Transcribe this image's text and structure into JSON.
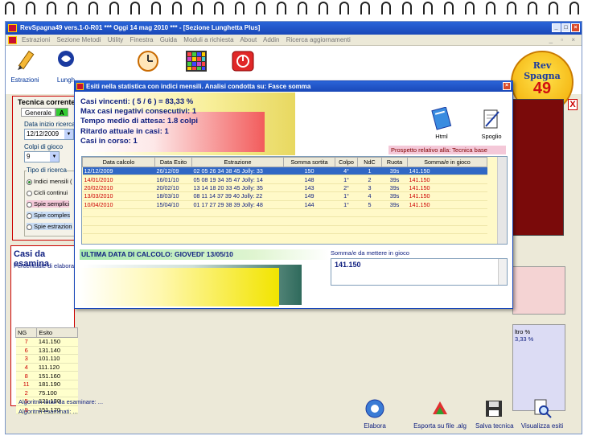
{
  "window": {
    "title": "RevSpagna49 vers.1-0-R01  ***  Oggi 14 mag 2010  ***  - [Sezione Lunghetta Plus]"
  },
  "menu": [
    "Estrazioni",
    "Sezione Metodi",
    "Utility",
    "Finestra",
    "Guida",
    "Moduli a richiesta",
    "About",
    "Addin",
    "Ricerca aggiornamenti"
  ],
  "toolbar": {
    "estrazioni": "Estrazioni",
    "lunghetta": "Lungh"
  },
  "logo": {
    "l1": "Rev",
    "l2": "Spagna",
    "l3": "49"
  },
  "left_panel": {
    "title": "Tecnica corrente:",
    "tab_general": "Generale",
    "tab_a": "A",
    "data_inizio_label": "Data inizio ricerca",
    "data_inizio_value": "12/12/2009",
    "colpi_label": "Colpi di gioco",
    "colpi_value": "9",
    "tipo_ricerca_label": "Tipo di ricerca",
    "options": [
      "Indici mensili (",
      "Cicli continui",
      "Spie semplici",
      "Spie comples",
      "Spie estrazion"
    ]
  },
  "cases_panel": {
    "title": "Casi da esamina",
    "subtitle": "Percentuale di elabora:"
  },
  "ng_table": {
    "headers": [
      "NG",
      "Esito"
    ],
    "rows": [
      [
        "7",
        "141.150"
      ],
      [
        "6",
        "131.140"
      ],
      [
        "3",
        "101.110"
      ],
      [
        "4",
        "111.120"
      ],
      [
        "8",
        "151.160"
      ],
      [
        "11",
        "181.190"
      ],
      [
        "2",
        "75.100"
      ],
      [
        "5",
        "121.130"
      ],
      [
        "9",
        "151.170"
      ]
    ]
  },
  "bottom_labels": {
    "totali": "Algoritmi totali da esaminare:  ...",
    "esaminati": "Algoritmi esaminati:  ..."
  },
  "right_panel": {
    "filtro": "ltro %",
    "pct": "3,33 %"
  },
  "bottom_buttons": [
    "Elabora",
    "Esporta su file .alg",
    "Salva tecnica",
    "Visualizza esiti"
  ],
  "dialog": {
    "title": "Esiti nella statistica con indici mensili. Analisi condotta su: Fasce somma",
    "summary": [
      "Casi vincenti: ( 5 / 6 ) = 83,33 %",
      "Max casi negativi consecutivi: 1",
      "Tempo medio di attesa: 1.8 colpi",
      "Ritardo attuale in casi: 1",
      "Casi in corso: 1"
    ],
    "html_label": "Html",
    "spoglio_label": "Spoglio",
    "prospetto": "Prospetto relativo alla: Tecnica base",
    "columns": [
      "Data calcolo",
      "Data Esito",
      "Estrazione",
      "Somma sortita",
      "Colpo",
      "NdC",
      "Ruota",
      "Somma/e in gioco"
    ],
    "rows": [
      [
        "12/12/2009",
        "26/12/09",
        "02 05 26 34 38 45 Jolly: 33",
        "150",
        "4°",
        "1",
        "39s",
        "141.150"
      ],
      [
        "14/01/2010",
        "16/01/10",
        "05 08 19 34 35 47 Jolly: 14",
        "148",
        "1°",
        "2",
        "39s",
        "141.150"
      ],
      [
        "20/02/2010",
        "20/02/10",
        "13 14 18 20 33 45 Jolly: 35",
        "143",
        "2°",
        "3",
        "39s",
        "141.150"
      ],
      [
        "13/03/2010",
        "18/03/10",
        "08 11 14 37 39 40 Jolly: 22",
        "149",
        "1°",
        "4",
        "39s",
        "141.150"
      ],
      [
        "10/04/2010",
        "15/04/10",
        "01 17 27 29 38 39 Jolly: 48",
        "144",
        "1°",
        "5",
        "39s",
        "141.150"
      ]
    ],
    "ultima": "ULTIMA DATA DI CALCOLO: GIOVEDI' 13/05/10",
    "somme_label": "Somma/e da mettere in gioco",
    "somme_value": "141.150"
  }
}
